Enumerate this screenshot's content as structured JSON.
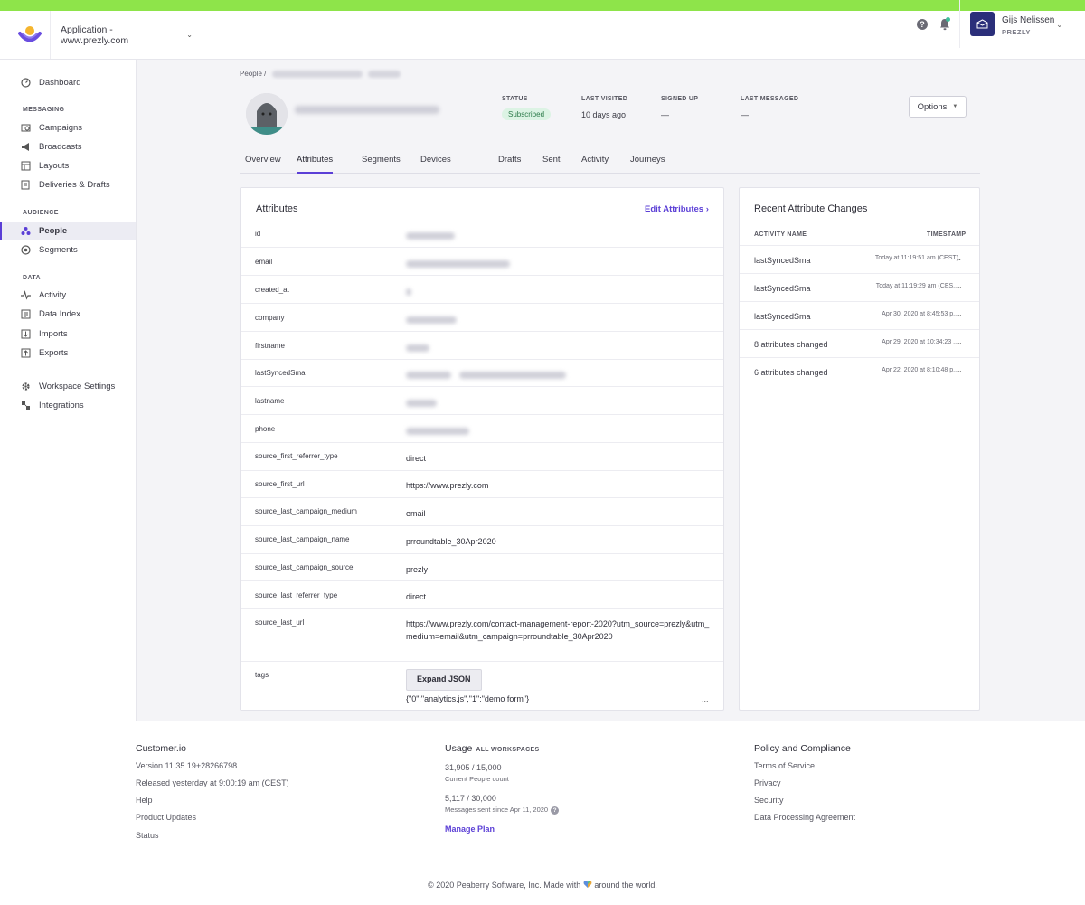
{
  "header": {
    "app_name": "Application - www.prezly.com",
    "help_icon": "?",
    "user_name": "Gijs Nelissen",
    "user_org": "PREZLY"
  },
  "sidebar": {
    "items": [
      {
        "label": "Dashboard",
        "icon": "dashboard-icon"
      },
      {
        "section": "MESSAGING"
      },
      {
        "label": "Campaigns",
        "icon": "campaigns-icon"
      },
      {
        "label": "Broadcasts",
        "icon": "megaphone-icon"
      },
      {
        "label": "Layouts",
        "icon": "layouts-icon"
      },
      {
        "label": "Deliveries & Drafts",
        "icon": "deliveries-icon"
      },
      {
        "section": "AUDIENCE"
      },
      {
        "label": "People",
        "icon": "people-icon",
        "active": true
      },
      {
        "label": "Segments",
        "icon": "segments-icon"
      },
      {
        "section": "DATA"
      },
      {
        "label": "Activity",
        "icon": "activity-icon"
      },
      {
        "label": "Data Index",
        "icon": "data-index-icon"
      },
      {
        "label": "Imports",
        "icon": "imports-icon"
      },
      {
        "label": "Exports",
        "icon": "exports-icon"
      },
      {
        "label": "Workspace Settings",
        "icon": "gear-icon"
      },
      {
        "label": "Integrations",
        "icon": "integrations-icon"
      }
    ]
  },
  "breadcrumb": {
    "root": "People",
    "sep": "/"
  },
  "profile": {
    "status_label": "STATUS",
    "status_value": "Subscribed",
    "last_visited_label": "LAST VISITED",
    "last_visited_value": "10 days ago",
    "signed_up_label": "SIGNED UP",
    "signed_up_value": "—",
    "last_messaged_label": "LAST MESSAGED",
    "last_messaged_value": "—",
    "options_label": "Options"
  },
  "tabs": [
    "Overview",
    "Attributes",
    "Segments",
    "Devices",
    "Drafts",
    "Sent",
    "Activity",
    "Journeys"
  ],
  "attributes": {
    "title": "Attributes",
    "edit_label": "Edit Attributes ›",
    "rows": [
      {
        "key": "id",
        "value": ""
      },
      {
        "key": "email",
        "value": ""
      },
      {
        "key": "created_at",
        "value": ""
      },
      {
        "key": "company",
        "value": ""
      },
      {
        "key": "firstname",
        "value": ""
      },
      {
        "key": "lastSyncedSma",
        "value": ""
      },
      {
        "key": "lastname",
        "value": ""
      },
      {
        "key": "phone",
        "value": ""
      },
      {
        "key": "source_first_referrer_type",
        "value": "direct"
      },
      {
        "key": "source_first_url",
        "value": "https://www.prezly.com"
      },
      {
        "key": "source_last_campaign_medium",
        "value": "email"
      },
      {
        "key": "source_last_campaign_name",
        "value": "prroundtable_30Apr2020"
      },
      {
        "key": "source_last_campaign_source",
        "value": "prezly"
      },
      {
        "key": "source_last_referrer_type",
        "value": "direct"
      },
      {
        "key": "source_last_url",
        "value": "https://www.prezly.com/contact-management-report-2020?utm_source=prezly&utm_medium=email&utm_campaign=prroundtable_30Apr2020"
      },
      {
        "key": "tags",
        "value": "{\"0\":\"analytics.js\",\"1\":\"demo form\"}"
      }
    ],
    "expand_label": "Expand JSON",
    "ellipsis": "..."
  },
  "recent": {
    "title": "Recent Attribute Changes",
    "col_name": "ACTIVITY NAME",
    "col_time": "TIMESTAMP",
    "rows": [
      {
        "name": "lastSyncedSma",
        "time": "Today at 11:19:51 am (CEST)"
      },
      {
        "name": "lastSyncedSma",
        "time": "Today at 11:19:29 am (CES..."
      },
      {
        "name": "lastSyncedSma",
        "time": "Apr 30, 2020 at 8:45:53 p..."
      },
      {
        "name": "8 attributes changed",
        "time": "Apr 29, 2020 at 10:34:23 ..."
      },
      {
        "name": "6 attributes changed",
        "time": "Apr 22, 2020 at 8:10:48 p..."
      }
    ]
  },
  "footer": {
    "brand": "Customer.io",
    "version": "Version 11.35.19+28266798",
    "released": "Released yesterday at 9:00:19 am (CEST)",
    "links": [
      "Help",
      "Product Updates",
      "Status"
    ],
    "usage_title": "Usage",
    "usage_tag": "ALL WORKSPACES",
    "people_count": "31,905 / 15,000",
    "people_label": "Current People count",
    "messages_count": "5,117 / 30,000",
    "messages_label": "Messages sent since Apr 11, 2020",
    "manage_plan": "Manage Plan",
    "policy_title": "Policy and Compliance",
    "policy_links": [
      "Terms of Service",
      "Privacy",
      "Security",
      "Data Processing Agreement"
    ],
    "copyright_pre": "© 2020 Peaberry Software, Inc. Made with",
    "copyright_post": "around the world."
  },
  "colors": {
    "accent": "#5b3fd6",
    "top_bar": "#8ee44a",
    "badge_bg": "#dcf3e4",
    "badge_text": "#2c7a4a",
    "avatar_bg": "#2b2f7a"
  }
}
